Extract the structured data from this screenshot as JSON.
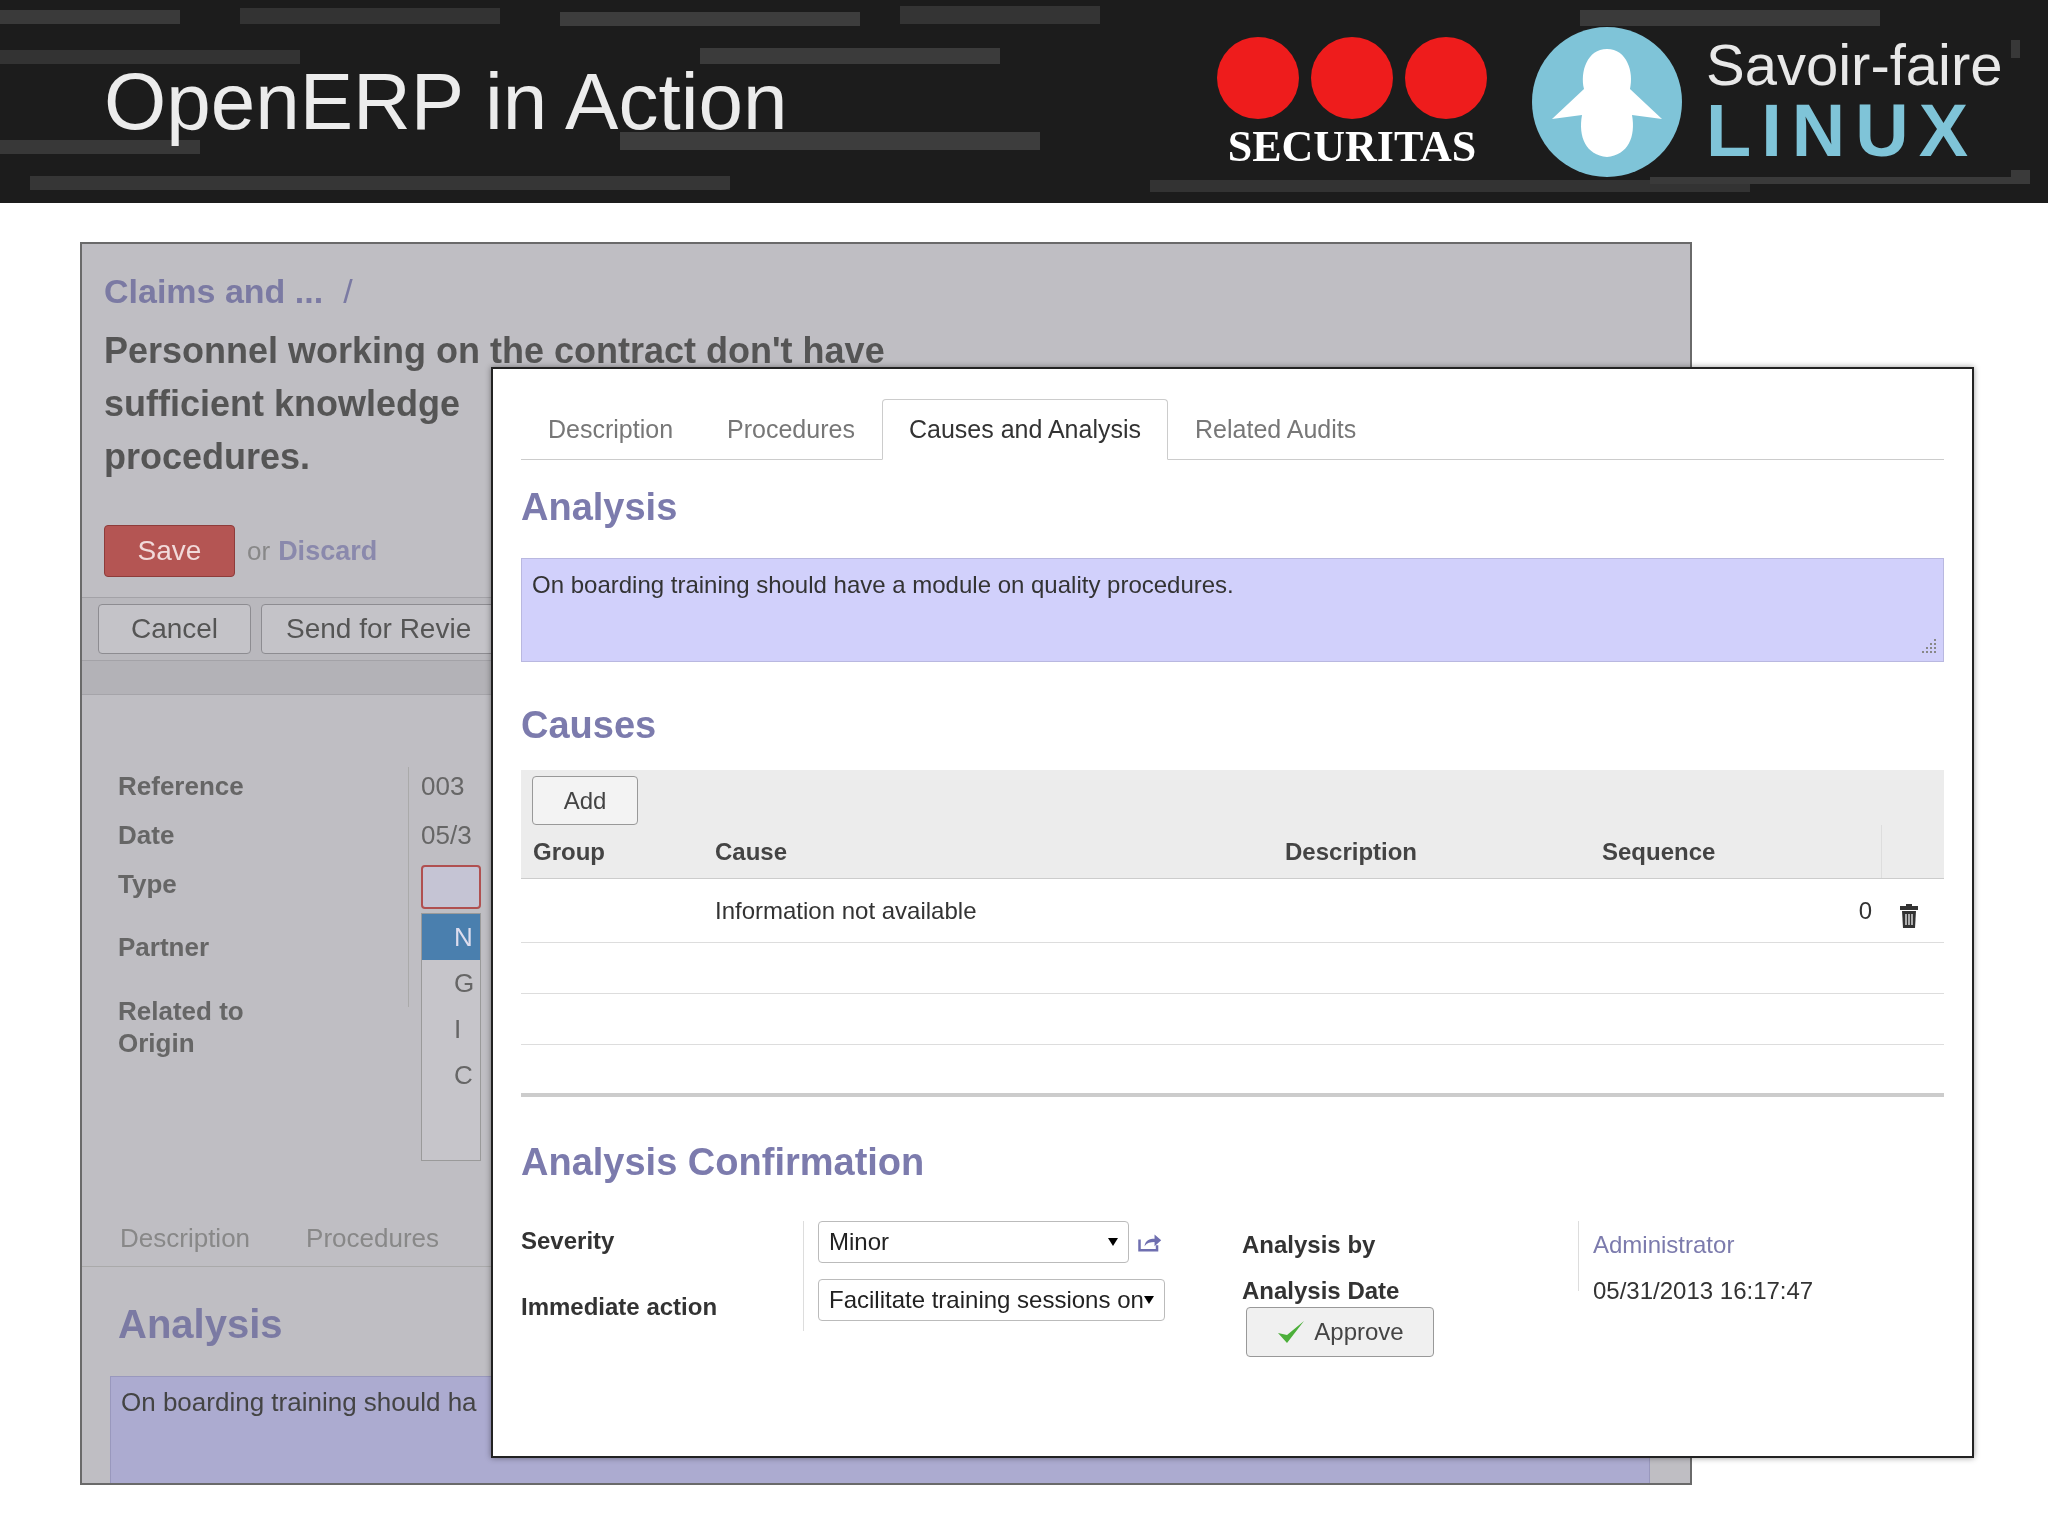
{
  "header": {
    "title": "OpenERP in Action",
    "logos": [
      {
        "kind": "dots",
        "lines": [
          "SECURITAS"
        ]
      },
      {
        "kind": "penguin",
        "lines": [
          "Savoir-faire",
          "LINUX"
        ]
      }
    ]
  },
  "back_window": {
    "breadcrumb": "Claims and ...",
    "separator": "/",
    "title_lines": [
      "Personnel working on the contract don't have",
      "sufficient knowledge",
      "procedures."
    ],
    "save": "Save",
    "or": "or",
    "discard": "Discard",
    "buttons": [
      "Cancel",
      "Send for Revie"
    ],
    "fields": [
      {
        "label": "Reference",
        "kind": "text",
        "value": "003"
      },
      {
        "label": "Date",
        "kind": "text",
        "value": "05/3"
      },
      {
        "label": "Type",
        "kind": "select"
      },
      {
        "label": "Partner",
        "kind": "empty"
      },
      {
        "label": "Related to",
        "kind": "empty"
      },
      {
        "label": "Origin",
        "kind": "empty"
      }
    ],
    "dropdown": [
      {
        "text": "N",
        "selected": true
      },
      {
        "text": "G",
        "selected": false
      },
      {
        "text": "I",
        "selected": false
      },
      {
        "text": "C",
        "selected": false
      }
    ],
    "tabs": [
      {
        "label": "Description",
        "selected": false
      },
      {
        "label": "Procedures",
        "selected": false
      }
    ],
    "section": "Analysis",
    "analysis_text": "On boarding training should ha"
  },
  "dialog": {
    "tabs": [
      {
        "label": "Description",
        "selected": false
      },
      {
        "label": "Procedures",
        "selected": false
      },
      {
        "label": "Causes and Analysis",
        "selected": true
      },
      {
        "label": "Related Audits",
        "selected": false
      }
    ],
    "analysis_title": "Analysis",
    "analysis_text": "On boarding training should have a module on quality procedures.",
    "causes_title": "Causes",
    "add": "Add",
    "columns": [
      "Group",
      "Cause",
      "Description",
      "Sequence"
    ],
    "rows": [
      {
        "cause": "Information not available",
        "sequence": "0"
      }
    ],
    "confirmation_title": "Analysis Confirmation",
    "left_fields": [
      {
        "label": "Severity",
        "value": "Minor"
      },
      {
        "label": "Immediate action",
        "value": "Facilitate training sessions on"
      }
    ],
    "right_fields": [
      {
        "label": "Analysis by",
        "value": "Administrator",
        "kind": "link"
      },
      {
        "label": "Analysis Date",
        "value": "05/31/2013 16:17:47",
        "kind": "text"
      }
    ],
    "approve": "Approve"
  }
}
